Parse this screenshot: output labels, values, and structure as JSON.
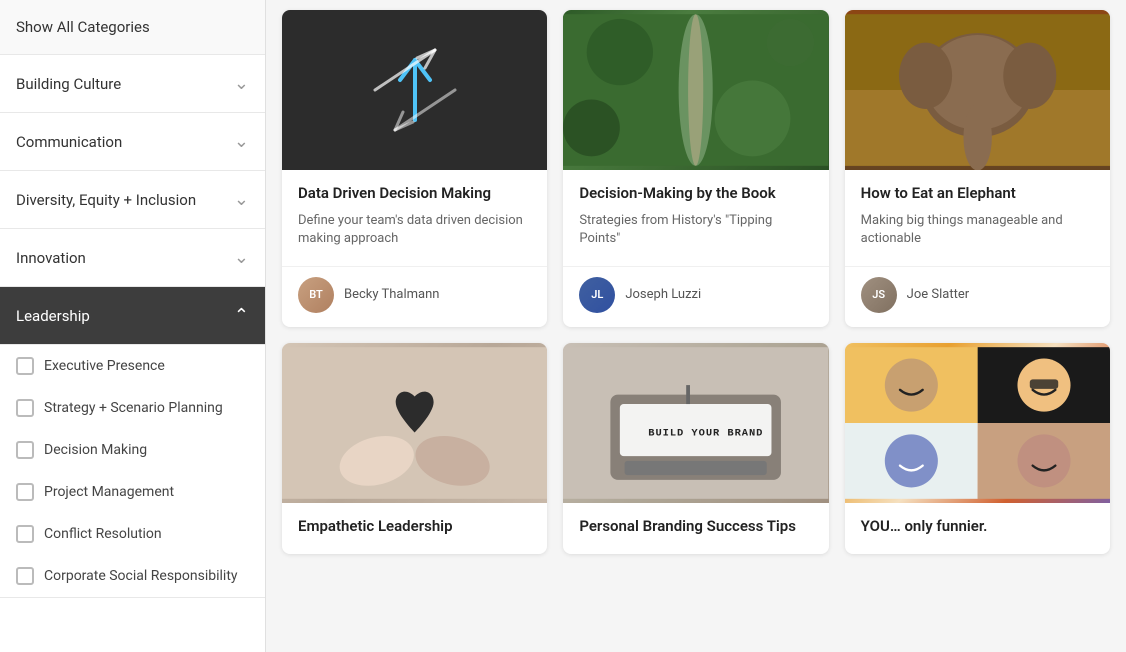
{
  "sidebar": {
    "items": [
      {
        "id": "show-all",
        "label": "Show All Categories",
        "active": false,
        "expandable": false
      },
      {
        "id": "building-culture",
        "label": "Building Culture",
        "active": false,
        "expandable": true
      },
      {
        "id": "communication",
        "label": "Communication",
        "active": false,
        "expandable": true
      },
      {
        "id": "diversity-equity",
        "label": "Diversity, Equity + Inclusion",
        "active": false,
        "expandable": true
      },
      {
        "id": "innovation",
        "label": "Innovation",
        "active": false,
        "expandable": true
      },
      {
        "id": "leadership",
        "label": "Leadership",
        "active": true,
        "expandable": true,
        "expanded": true
      }
    ],
    "subitems": [
      {
        "id": "executive-presence",
        "label": "Executive Presence",
        "checked": false
      },
      {
        "id": "strategy-scenario",
        "label": "Strategy + Scenario Planning",
        "checked": false
      },
      {
        "id": "decision-making",
        "label": "Decision Making",
        "checked": false
      },
      {
        "id": "project-management",
        "label": "Project Management",
        "checked": false
      },
      {
        "id": "conflict-resolution",
        "label": "Conflict Resolution",
        "checked": false
      },
      {
        "id": "corporate-social",
        "label": "Corporate Social Responsibility",
        "checked": false
      }
    ]
  },
  "cards": [
    {
      "id": "data-driven",
      "title": "Data Driven Decision Making",
      "description": "Define your team's data driven decision making approach",
      "author": "Becky Thalmann",
      "author_initials": "BT",
      "author_avatar_class": "avatar-becky",
      "img_type": "arrows"
    },
    {
      "id": "decision-book",
      "title": "Decision-Making by the Book",
      "description": "Strategies from History's \"Tipping Points\"",
      "author": "Joseph Luzzi",
      "author_initials": "JL",
      "author_avatar_class": "avatar-joseph",
      "img_type": "path"
    },
    {
      "id": "elephant",
      "title": "How to Eat an Elephant",
      "description": "Making big things manageable and actionable",
      "author": "Joe Slatter",
      "author_initials": "JS",
      "author_avatar_class": "avatar-joe",
      "img_type": "elephant"
    },
    {
      "id": "empathetic-leadership",
      "title": "Empathetic Leadership",
      "description": "",
      "author": "",
      "author_initials": "",
      "author_avatar_class": "",
      "img_type": "hands"
    },
    {
      "id": "personal-branding",
      "title": "Personal Branding Success Tips",
      "description": "",
      "author": "",
      "author_initials": "",
      "author_avatar_class": "",
      "img_type": "typewriter"
    },
    {
      "id": "you-funnier",
      "title": "YOU… only funnier.",
      "description": "",
      "author": "",
      "author_initials": "",
      "author_avatar_class": "",
      "img_type": "people"
    }
  ],
  "icons": {
    "chevron_down": "⌄",
    "chevron_up": "⌃"
  }
}
